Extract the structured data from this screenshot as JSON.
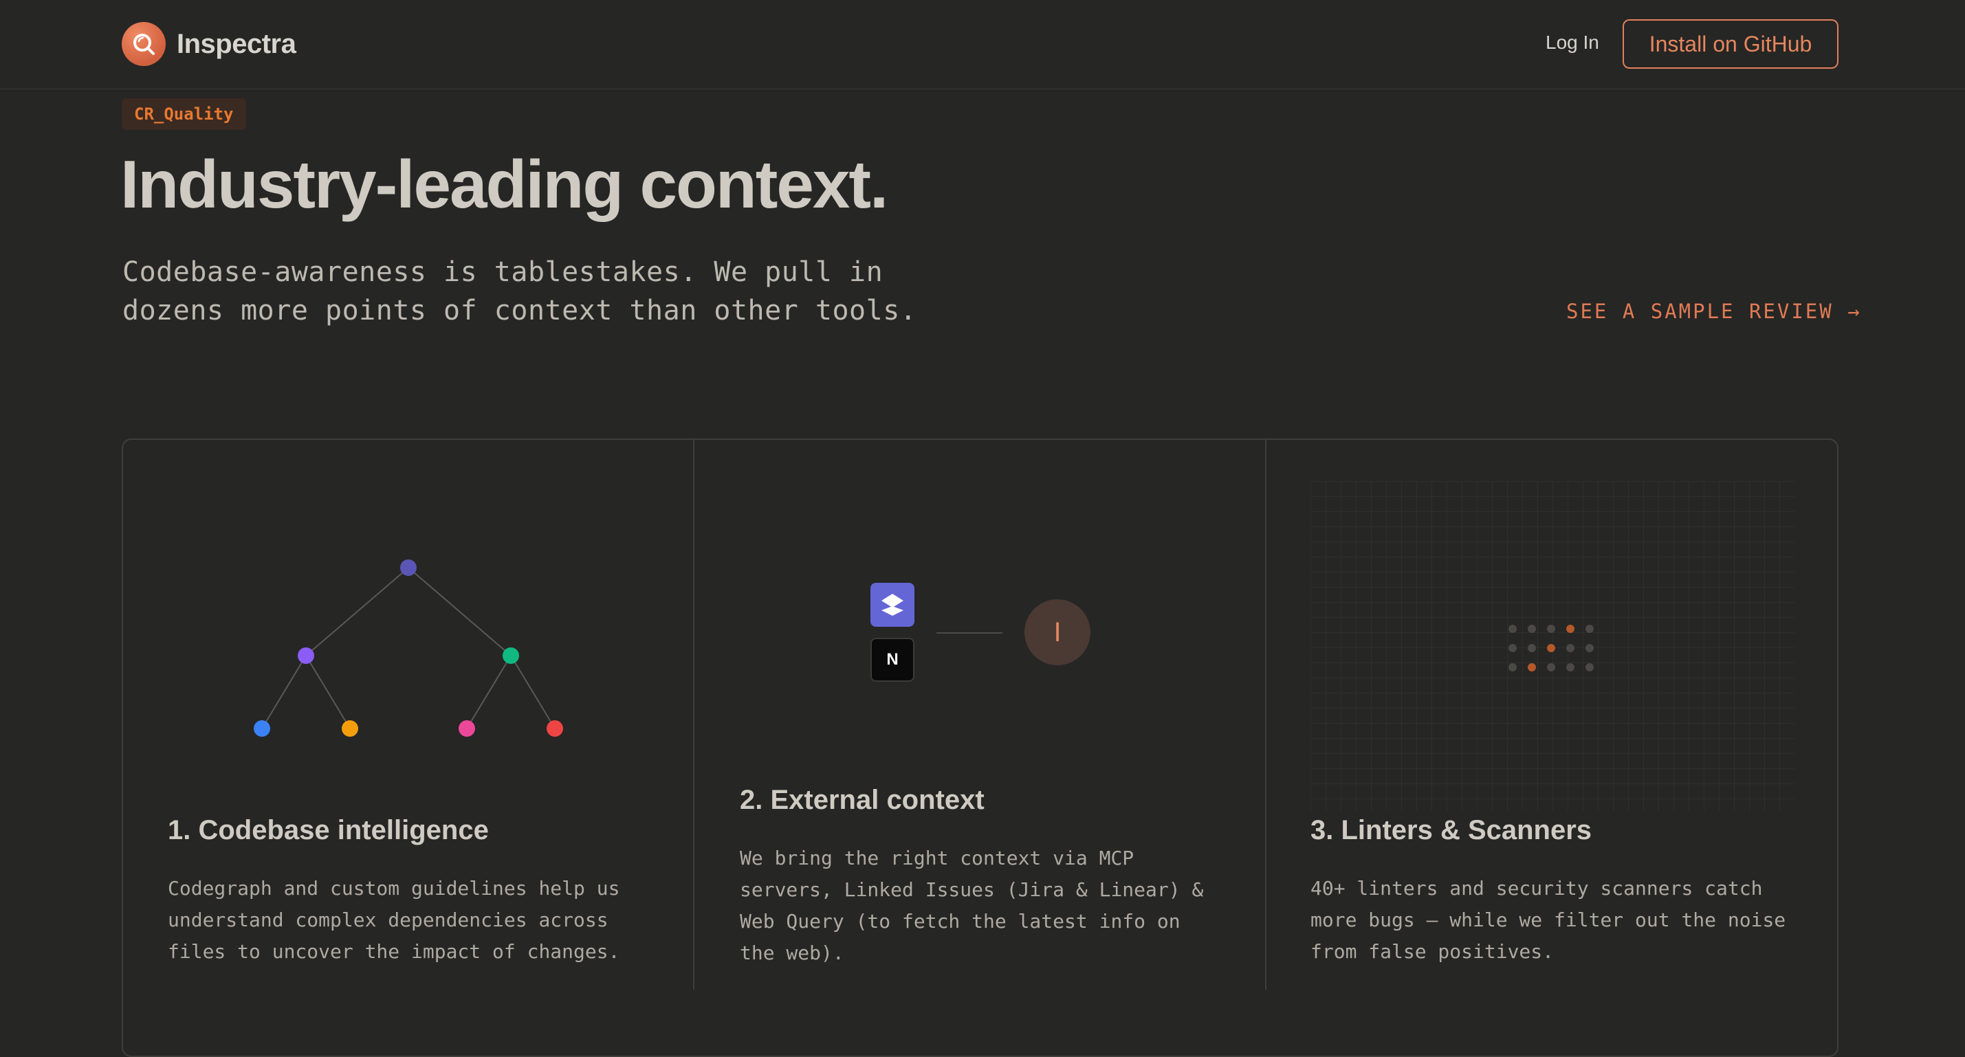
{
  "nav": {
    "brand": "Inspectra",
    "login_label": "Log In",
    "install_label": "Install on GitHub"
  },
  "hero": {
    "tag": "CR_Quality",
    "headline": "Industry-leading context.",
    "subline_1": "Codebase-awareness is tablestakes. We pull in",
    "subline_2": "dozens more points of context than other tools.",
    "sample_link": "SEE A SAMPLE REVIEW →"
  },
  "cards": [
    {
      "title": "1. Codebase intelligence",
      "body_lines": [
        "Codegraph and custom guidelines help us",
        "understand complex dependencies across",
        "files to uncover the impact of changes."
      ]
    },
    {
      "title": "2. External context",
      "body_lines": [
        "We bring the right context via MCP",
        "servers, Linked Issues (Jira & Linear) &",
        "Web Query (to fetch the latest info on",
        "the web)."
      ],
      "icon_n": "N",
      "avatar_letter": "I"
    },
    {
      "title": "3. Linters & Scanners",
      "body_lines": [
        "40+ linters and security scanners catch",
        "more bugs — while we filter out the noise",
        "from false positives."
      ]
    }
  ],
  "colors": {
    "background": "#262624",
    "accent": "#e07a55",
    "tag_text": "#e8782f",
    "tree_root": "#5b56b6",
    "tree_left": "#8b5cf6",
    "tree_right": "#10b981",
    "leaf_1": "#3b82f6",
    "leaf_2": "#f59e0b",
    "leaf_3": "#ec4899",
    "leaf_4": "#ef4444",
    "linear_icon": "#6466d6"
  },
  "icons": {
    "brand": "magnifier-icon",
    "arrow": "arrow-right-icon",
    "tool_1": "linear-icon",
    "tool_2": "notion-icon"
  }
}
